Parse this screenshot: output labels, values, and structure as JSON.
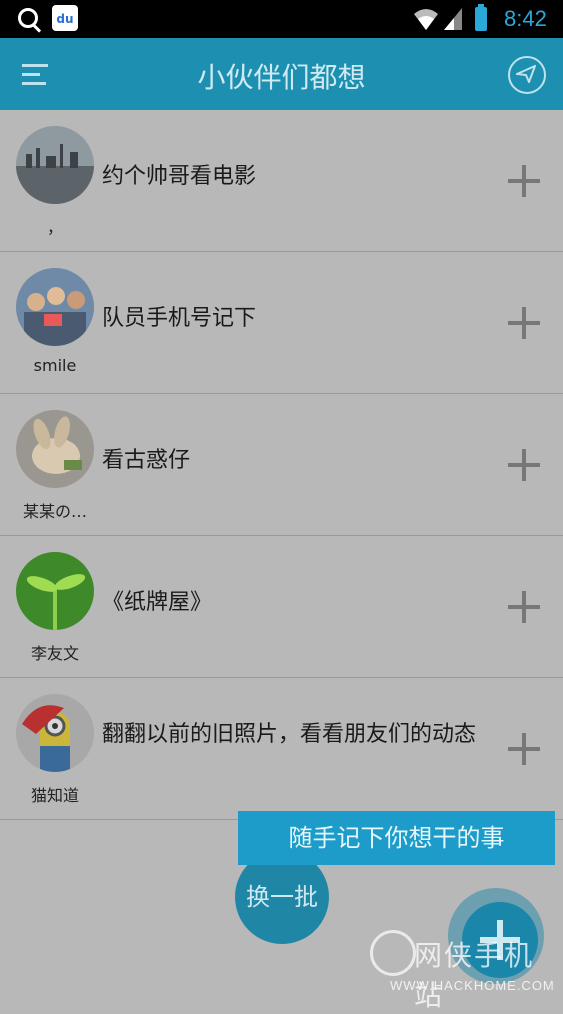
{
  "status_bar": {
    "time": "8:42",
    "baidu_label": "du"
  },
  "app_bar": {
    "title": "小伙伴们都想"
  },
  "items": [
    {
      "username": "，",
      "text": "约个帅哥看电影"
    },
    {
      "username": "smile",
      "text": "队员手机号记下"
    },
    {
      "username": "某某の…",
      "text": "看古惑仔"
    },
    {
      "username": "李友文",
      "text": "《纸牌屋》"
    },
    {
      "username": "猫知道",
      "text": "翻翻以前的旧照片，看看朋友们的动态"
    }
  ],
  "tip": "随手记下你想干的事",
  "refresh_button": "换一批",
  "watermark": {
    "cn": "网侠手机站",
    "url": "WWW.HACKHOME.COM"
  },
  "colors": {
    "app_bar": "#1d8fb0",
    "accent": "#1e9cc9",
    "overlay_bg": "#b8b8b8"
  },
  "icons": [
    "search-icon",
    "baidu-icon",
    "wifi-icon",
    "signal-icon",
    "battery-icon",
    "menu-icon",
    "send-icon",
    "plus-icon"
  ]
}
